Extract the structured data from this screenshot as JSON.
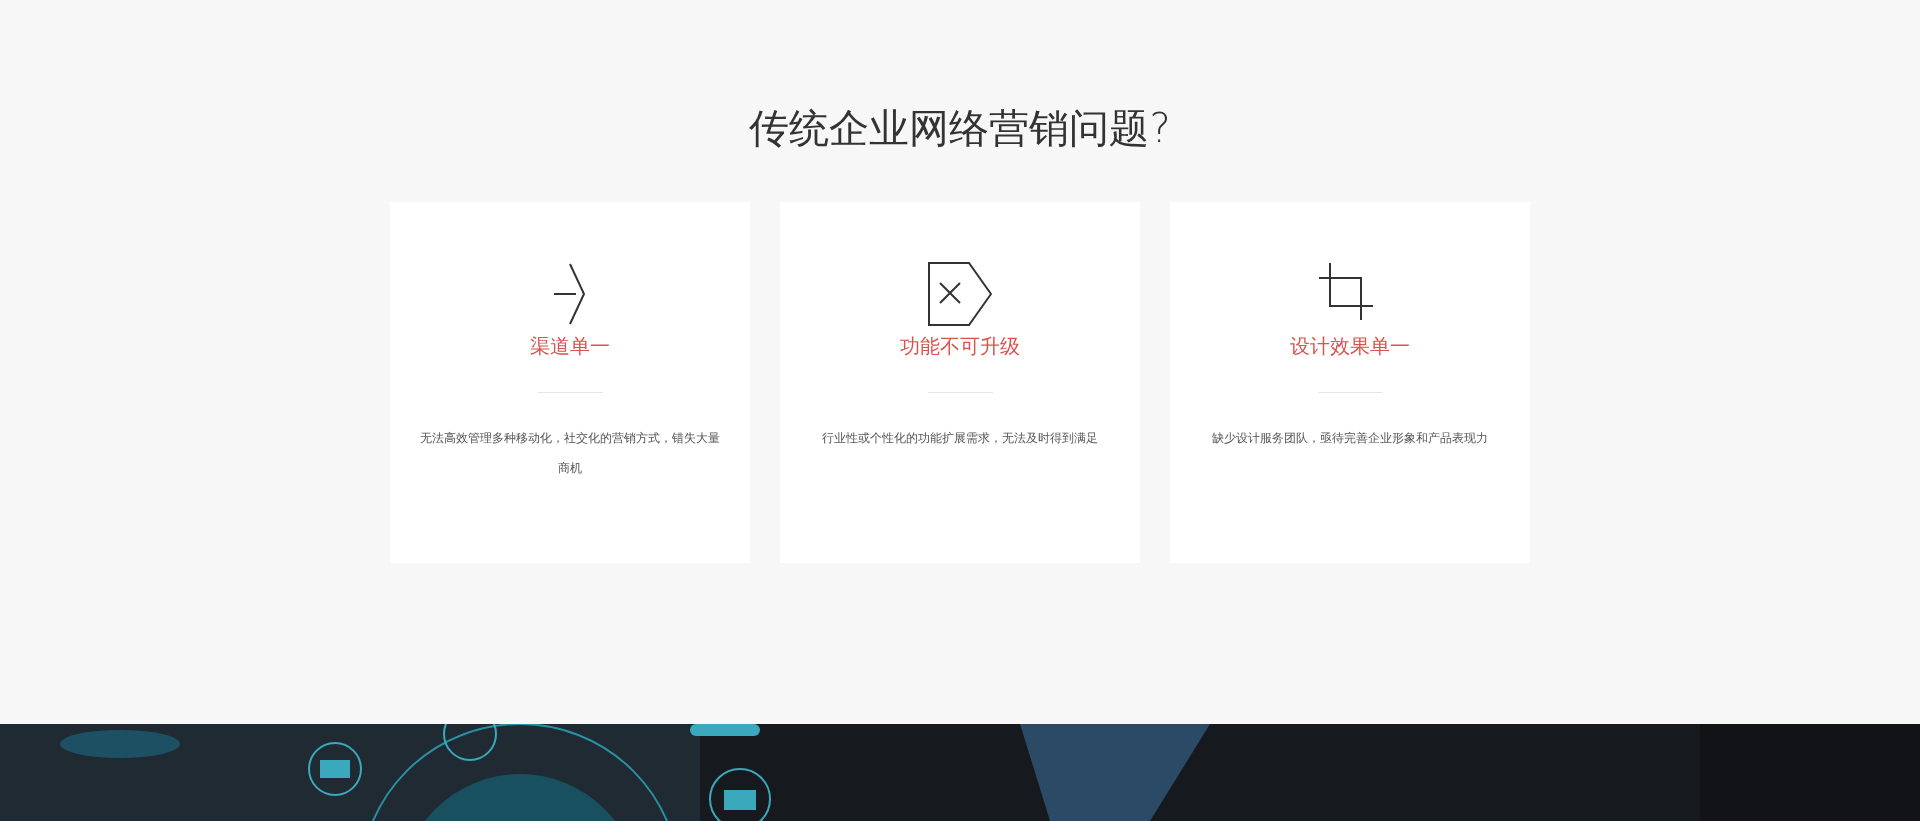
{
  "section_title": "传统企业网络营销问题?",
  "cards": [
    {
      "kind": "arrow",
      "title": "渠道单一",
      "description": "无法高效管理多种移动化，社交化的营销方式，错失大量商机"
    },
    {
      "kind": "tag-x",
      "title": "功能不可升级",
      "description": "行业性或个性化的功能扩展需求，无法及时得到满足"
    },
    {
      "kind": "crop",
      "title": "设计效果单一",
      "description": "缺少设计服务团队，亟待完善企业形象和产品表现力"
    }
  ]
}
